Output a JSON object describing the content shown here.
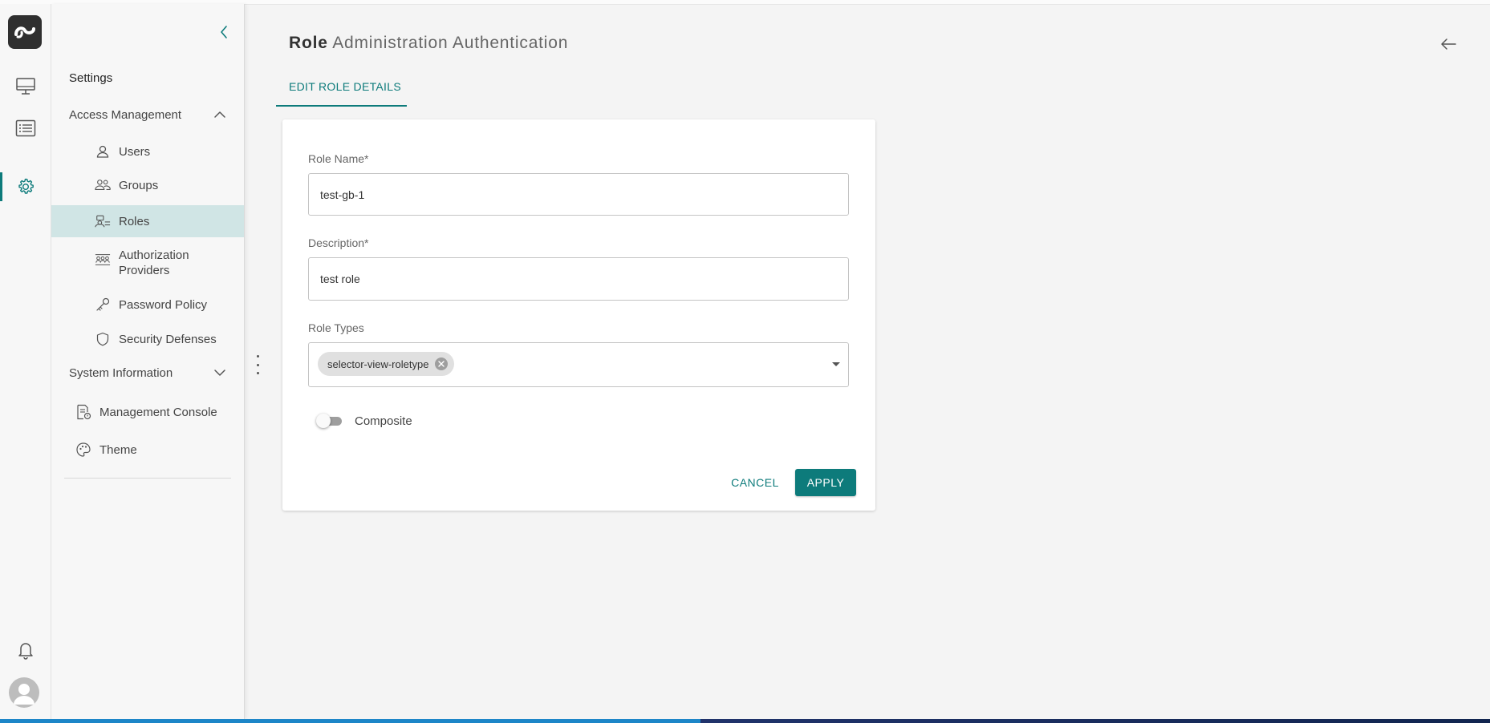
{
  "sidenav": {
    "title": "Settings",
    "sections": [
      {
        "label": "Access Management",
        "expanded": true
      },
      {
        "label": "System Information",
        "expanded": false
      }
    ],
    "access_items": [
      {
        "label": "Users",
        "icon": "user-icon"
      },
      {
        "label": "Groups",
        "icon": "groups-icon"
      },
      {
        "label": "Roles",
        "icon": "roles-icon",
        "active": true
      },
      {
        "label": "Authorization Providers",
        "icon": "authorization-providers-icon"
      },
      {
        "label": "Password Policy",
        "icon": "key-icon"
      },
      {
        "label": "Security Defenses",
        "icon": "shield-icon"
      }
    ],
    "other_items": [
      {
        "label": "Management Console",
        "icon": "management-console-icon"
      },
      {
        "label": "Theme",
        "icon": "palette-icon"
      }
    ]
  },
  "rail": {
    "items": [
      {
        "icon": "monitor-icon"
      },
      {
        "icon": "list-icon"
      },
      {
        "icon": "gear-icon",
        "active": true
      }
    ],
    "bottom": [
      {
        "icon": "bell-icon"
      },
      {
        "icon": "avatar-icon"
      }
    ]
  },
  "header": {
    "title_bold": "Role",
    "title_rest": "Administration Authentication"
  },
  "tabs": [
    {
      "label": "EDIT ROLE DETAILS",
      "active": true
    }
  ],
  "form": {
    "role_name_label": "Role Name*",
    "role_name_value": "test-gb-1",
    "description_label": "Description*",
    "description_value": "test role",
    "role_types_label": "Role Types",
    "role_types_chips": [
      "selector-view-roletype"
    ],
    "composite_label": "Composite",
    "composite_on": false,
    "cancel_label": "CANCEL",
    "apply_label": "APPLY"
  },
  "colors": {
    "accent": "#0d7b7b",
    "active_nav_bg": "#d0e5e5"
  }
}
